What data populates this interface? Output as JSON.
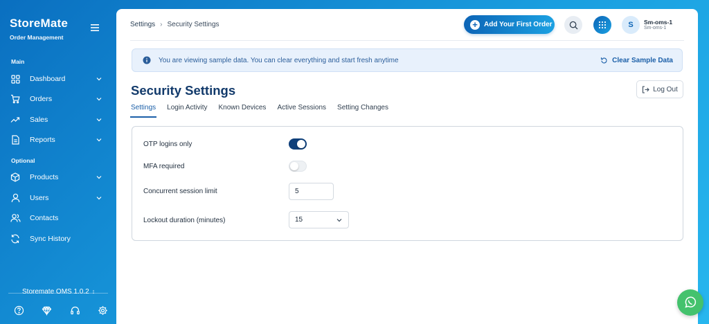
{
  "brand": {
    "name": "StoreMate",
    "subtitle": "Order Management"
  },
  "sidebar": {
    "sections": [
      {
        "label": "Main"
      },
      {
        "label": "Optional"
      }
    ],
    "main_items": [
      {
        "label": "Dashboard",
        "icon": "grid-icon",
        "has_submenu": true
      },
      {
        "label": "Orders",
        "icon": "cart-icon",
        "has_submenu": true
      },
      {
        "label": "Sales",
        "icon": "trending-up-icon",
        "has_submenu": true
      },
      {
        "label": "Reports",
        "icon": "document-icon",
        "has_submenu": true
      }
    ],
    "optional_items": [
      {
        "label": "Products",
        "icon": "box-icon",
        "has_submenu": true
      },
      {
        "label": "Users",
        "icon": "user-icon",
        "has_submenu": true
      },
      {
        "label": "Contacts",
        "icon": "contacts-icon",
        "has_submenu": false
      },
      {
        "label": "Sync History",
        "icon": "sync-icon",
        "has_submenu": false
      }
    ],
    "version": "Storemate OMS 1.0.2",
    "footer_icons": [
      "help-icon",
      "diamond-icon",
      "headset-icon",
      "settings-icon"
    ]
  },
  "header": {
    "breadcrumb": [
      "Settings",
      "Security Settings"
    ],
    "add_order_label": "Add Your First Order",
    "user": {
      "initial": "S",
      "name": "Sm-oms-1",
      "sub": "Sm-oms-1"
    }
  },
  "banner": {
    "text": "You are viewing sample data. You can clear everything and start fresh anytime",
    "action_label": "Clear Sample Data"
  },
  "page": {
    "title": "Security Settings",
    "logout_label": "Log Out",
    "tabs": [
      {
        "label": "Settings",
        "active": true
      },
      {
        "label": "Login Activity",
        "active": false
      },
      {
        "label": "Known Devices",
        "active": false
      },
      {
        "label": "Active Sessions",
        "active": false
      },
      {
        "label": "Setting Changes",
        "active": false
      }
    ]
  },
  "settings": {
    "otp_label": "OTP logins only",
    "otp_enabled": true,
    "mfa_label": "MFA required",
    "mfa_enabled": false,
    "concurrent_label": "Concurrent session limit",
    "concurrent_value": "5",
    "lockout_label": "Lockout duration (minutes)",
    "lockout_value": "15"
  },
  "colors": {
    "accent": "#1b5fa8",
    "title": "#123a6b",
    "toggle_on": "#0e3f7a",
    "whatsapp": "#44c26d"
  }
}
